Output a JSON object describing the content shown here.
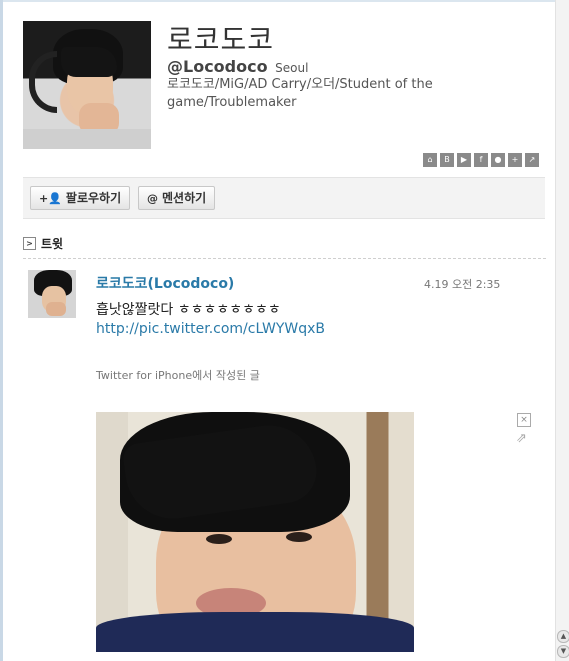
{
  "profile": {
    "display_name": "로코도코",
    "handle": "@Locodoco",
    "location": "Seoul",
    "bio": "로코도코/MiG/AD Carry/오더/Student of the game/Troublemaker"
  },
  "share_icons": [
    "home-icon",
    "blog-icon",
    "youtube-icon",
    "facebook-icon",
    "chat-icon",
    "plus-icon",
    "external-link-icon"
  ],
  "share_icon_glyphs": [
    "⌂",
    "B",
    "▶",
    "f",
    "●",
    "+",
    "↗"
  ],
  "actions": {
    "follow_label": "팔로우하기",
    "follow_glyph": "+👤",
    "mention_label": "멘션하기",
    "mention_glyph": "@"
  },
  "tweets_section": {
    "title": "트윗",
    "toggle_glyph": ">"
  },
  "tweet": {
    "author": "로코도코(Locodoco)",
    "time": "4.19 오전 2:35",
    "text": "흡낫않짤랏다 ㅎㅎㅎㅎㅎㅎㅎㅎ",
    "link": "http://pic.twitter.com/cLWYWqxB",
    "source": "Twitter for iPhone에서 작성된 글",
    "close_glyph": "×",
    "share_glyph": "⇗"
  },
  "scrollbar": {
    "up_glyph": "▲",
    "down_glyph": "▼"
  }
}
